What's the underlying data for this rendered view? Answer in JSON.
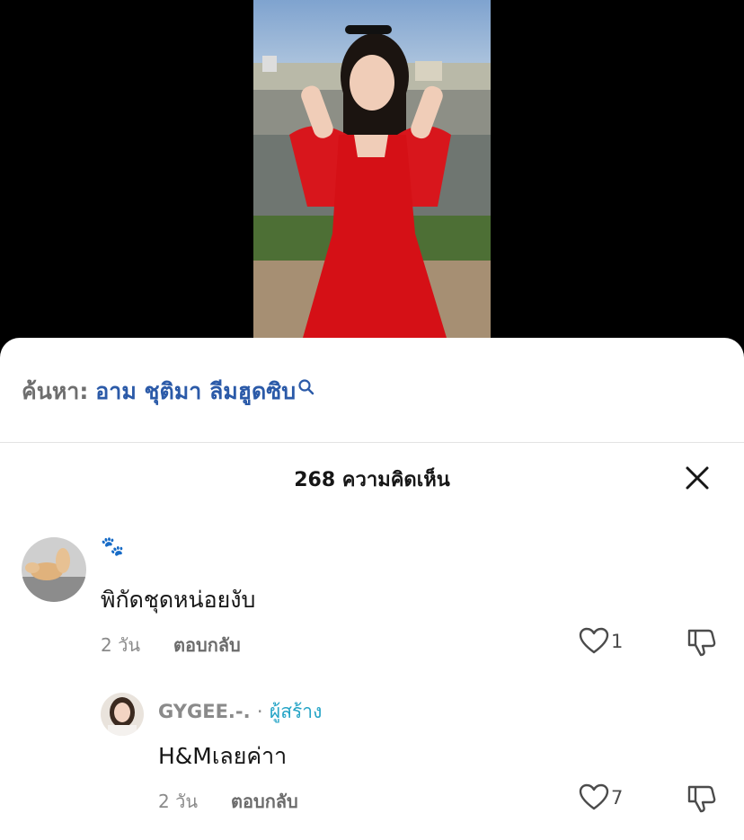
{
  "video": {
    "thumbnail_icon": "video-thumbnail-woman-red-dress"
  },
  "search": {
    "prefix": "ค้นหา:",
    "query": "อาม ชุติมา ลีมฮูดซิบ",
    "icon": "search-icon"
  },
  "comments_header": {
    "title": "268 ความคิดเห็น",
    "close_icon": "close-icon"
  },
  "comments": [
    {
      "username": "🐾",
      "text": "พิกัดชุดหน่อยงับ",
      "time": "2 วัน",
      "reply_label": "ตอบกลับ",
      "likes": "1"
    },
    {
      "username": "GYGEE.-.",
      "separator": "·",
      "creator_badge": "ผู้สร้าง",
      "text": "H&Mเลยค่าา",
      "time": "2 วัน",
      "reply_label": "ตอบกลับ",
      "likes": "7"
    }
  ],
  "colors": {
    "search_query": "#2b5aa8",
    "creator_badge": "#25a4c6",
    "background_sheet": "#ffffff"
  }
}
